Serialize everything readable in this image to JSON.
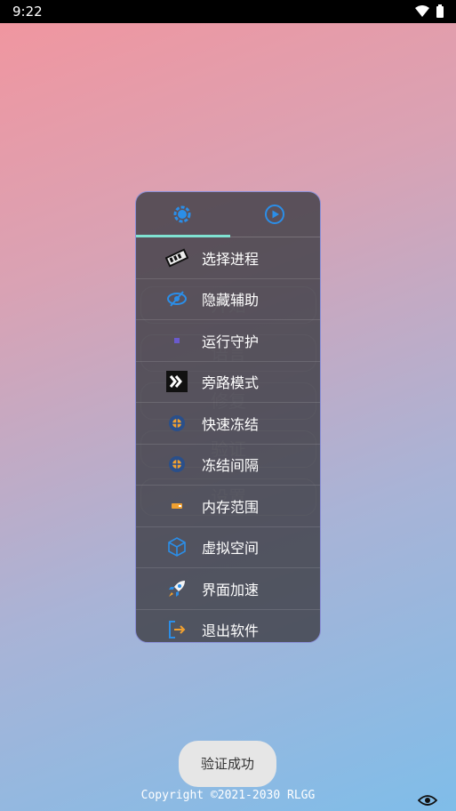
{
  "status_bar": {
    "time": "9:22"
  },
  "background_buttons": [
    "开始",
    "语言",
    "修复",
    "验证",
    "设置"
  ],
  "tabs": [
    {
      "icon": "gear-icon",
      "active": true
    },
    {
      "icon": "play-icon",
      "active": false
    }
  ],
  "menu": [
    {
      "label": "选择进程",
      "icon": "memory-chip-icon"
    },
    {
      "label": "隐藏辅助",
      "icon": "eye-off-icon"
    },
    {
      "label": "运行守护",
      "icon": "shield-icon"
    },
    {
      "label": "旁路模式",
      "icon": "bypass-icon"
    },
    {
      "label": "快速冻结",
      "icon": "snowflake-icon"
    },
    {
      "label": "冻结间隔",
      "icon": "snowflake-icon"
    },
    {
      "label": "内存范围",
      "icon": "memory-range-icon"
    },
    {
      "label": "虚拟空间",
      "icon": "cube-icon"
    },
    {
      "label": "界面加速",
      "icon": "rocket-icon"
    },
    {
      "label": "退出软件",
      "icon": "exit-icon"
    }
  ],
  "toast": "验证成功",
  "footer": {
    "copyright": "Copyright ©2021-2030 RLGG"
  },
  "colors": {
    "accent": "#2b8ee8",
    "panel_border": "#8a90d8",
    "tab_indicator": "#7fe3d2",
    "orange": "#f0a030"
  }
}
